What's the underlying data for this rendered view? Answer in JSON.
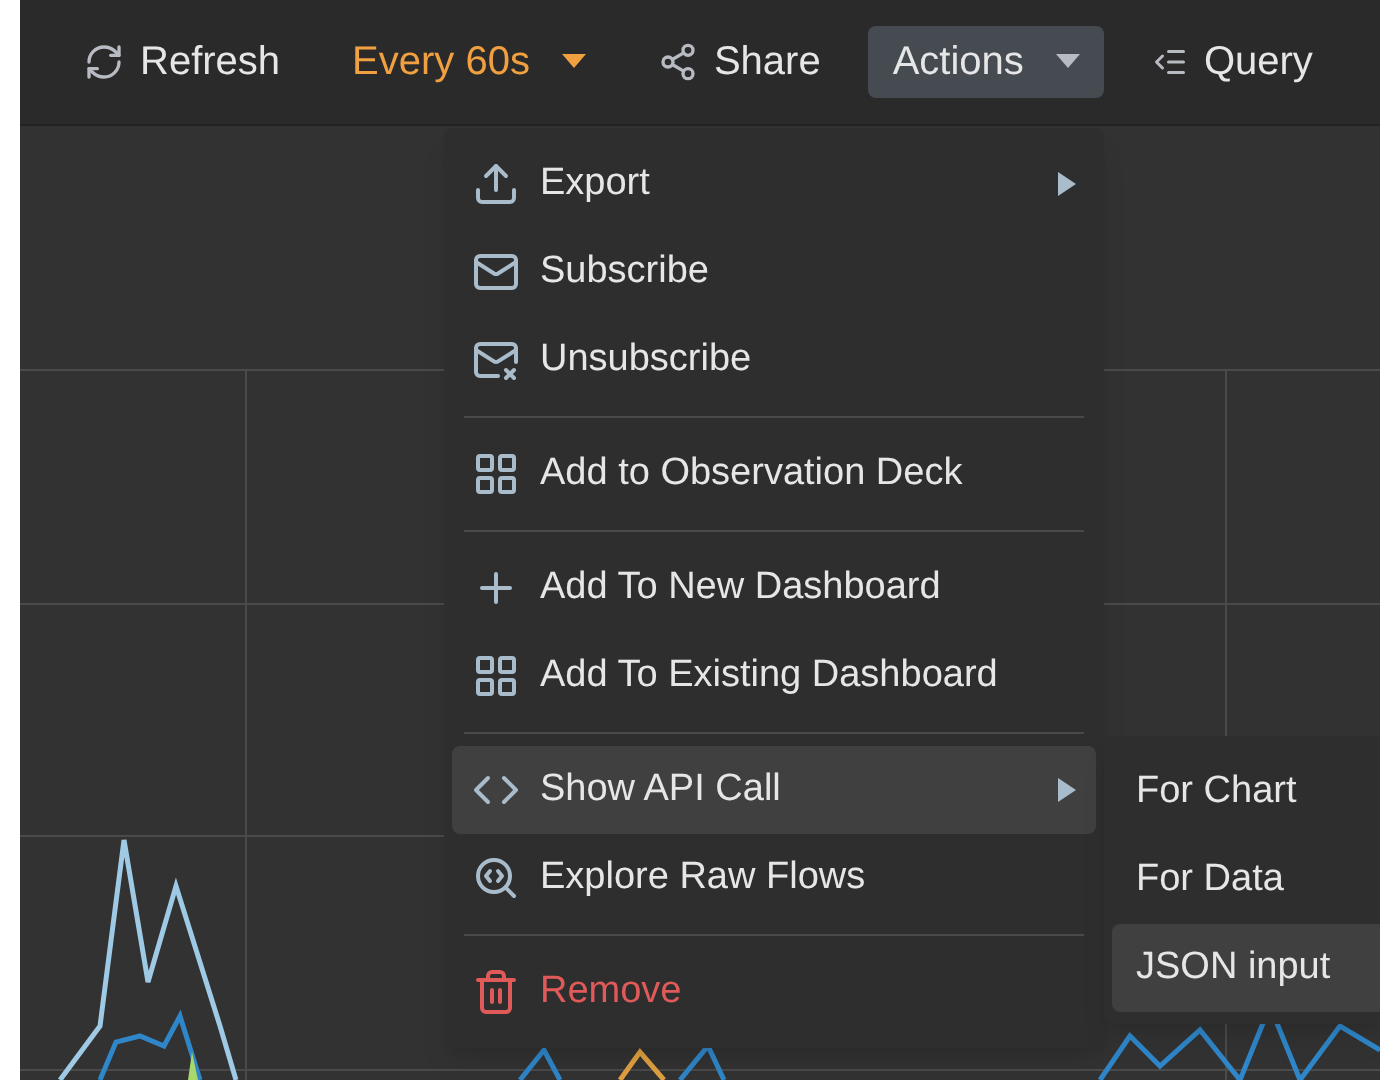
{
  "toolbar": [
    {
      "kind": "refresh",
      "label": "Refresh",
      "selected": false
    },
    {
      "kind": "interval",
      "label": "Every 60s",
      "selected": false
    },
    {
      "kind": "share",
      "label": "Share",
      "selected": false
    },
    {
      "kind": "actions",
      "label": "Actions",
      "selected": true
    },
    {
      "kind": "query",
      "label": "Query",
      "selected": false
    }
  ],
  "actions_menu": {
    "groups": [
      [
        {
          "label": "Export",
          "has_submenu": true,
          "selected": false,
          "danger": false
        },
        {
          "label": "Subscribe",
          "has_submenu": false,
          "selected": false,
          "danger": false
        },
        {
          "label": "Unsubscribe",
          "has_submenu": false,
          "selected": false,
          "danger": false
        }
      ],
      [
        {
          "label": "Add to Observation Deck",
          "has_submenu": false,
          "selected": false,
          "danger": false
        }
      ],
      [
        {
          "label": "Add To New Dashboard",
          "has_submenu": false,
          "selected": false,
          "danger": false
        },
        {
          "label": "Add To Existing Dashboard",
          "has_submenu": false,
          "selected": false,
          "danger": false
        }
      ],
      [
        {
          "label": "Show API Call",
          "has_submenu": true,
          "selected": true,
          "danger": false
        },
        {
          "label": "Explore Raw Flows",
          "has_submenu": false,
          "selected": false,
          "danger": false
        }
      ],
      [
        {
          "label": "Remove",
          "has_submenu": false,
          "selected": false,
          "danger": true
        }
      ]
    ]
  },
  "api_submenu": {
    "items": [
      {
        "label": "For Chart",
        "selected": false
      },
      {
        "label": "For Data",
        "selected": false
      },
      {
        "label": "JSON input",
        "selected": true
      }
    ]
  }
}
